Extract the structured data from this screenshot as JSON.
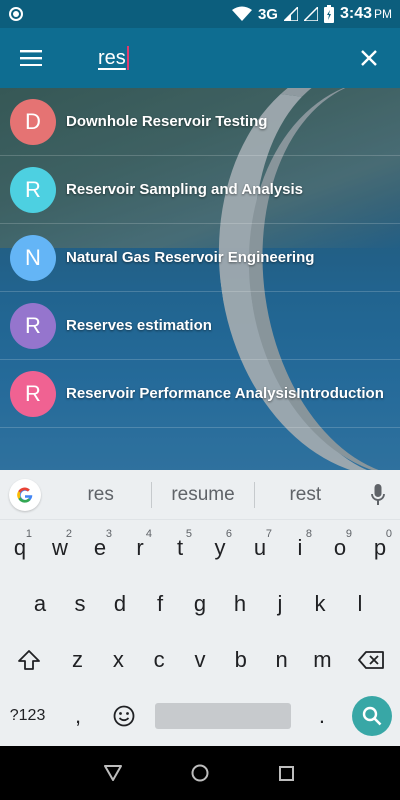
{
  "status_bar": {
    "network": "3G",
    "time": "3:43",
    "ampm": "PM",
    "icons": [
      "circle-icon",
      "wifi-icon",
      "signal-icon",
      "signal-empty-icon",
      "battery-charging-icon"
    ]
  },
  "app_bar": {
    "menu_icon": "hamburger-menu-icon",
    "search_value": "res",
    "close_icon": "close-icon"
  },
  "results": [
    {
      "letter": "D",
      "title": "Downhole Reservoir Testing",
      "color": "#e57373"
    },
    {
      "letter": "R",
      "title": "Reservoir Sampling and Analysis",
      "color": "#4dd0e1"
    },
    {
      "letter": "N",
      "title": "Natural Gas Reservoir Engineering",
      "color": "#64b5f6"
    },
    {
      "letter": "R",
      "title": "Reserves estimation",
      "color": "#9575cd"
    },
    {
      "letter": "R",
      "title": "Reservoir Performance AnalysisIntroduction",
      "color": "#f06292"
    }
  ],
  "keyboard": {
    "suggestions": [
      "res",
      "resume",
      "rest"
    ],
    "row1": [
      {
        "key": "q",
        "hint": "1"
      },
      {
        "key": "w",
        "hint": "2"
      },
      {
        "key": "e",
        "hint": "3"
      },
      {
        "key": "r",
        "hint": "4"
      },
      {
        "key": "t",
        "hint": "5"
      },
      {
        "key": "y",
        "hint": "6"
      },
      {
        "key": "u",
        "hint": "7"
      },
      {
        "key": "i",
        "hint": "8"
      },
      {
        "key": "o",
        "hint": "9"
      },
      {
        "key": "p",
        "hint": "0"
      }
    ],
    "row2": [
      "a",
      "s",
      "d",
      "f",
      "g",
      "h",
      "j",
      "k",
      "l"
    ],
    "row3": [
      "z",
      "x",
      "c",
      "v",
      "b",
      "n",
      "m"
    ],
    "symbols_label": "?123",
    "comma": ",",
    "period": "."
  },
  "colors": {
    "app_bar": "#0e6d91",
    "status_bar": "#0c5e7d",
    "accent": "#38a7a6",
    "cursor": "#e03a6f"
  }
}
